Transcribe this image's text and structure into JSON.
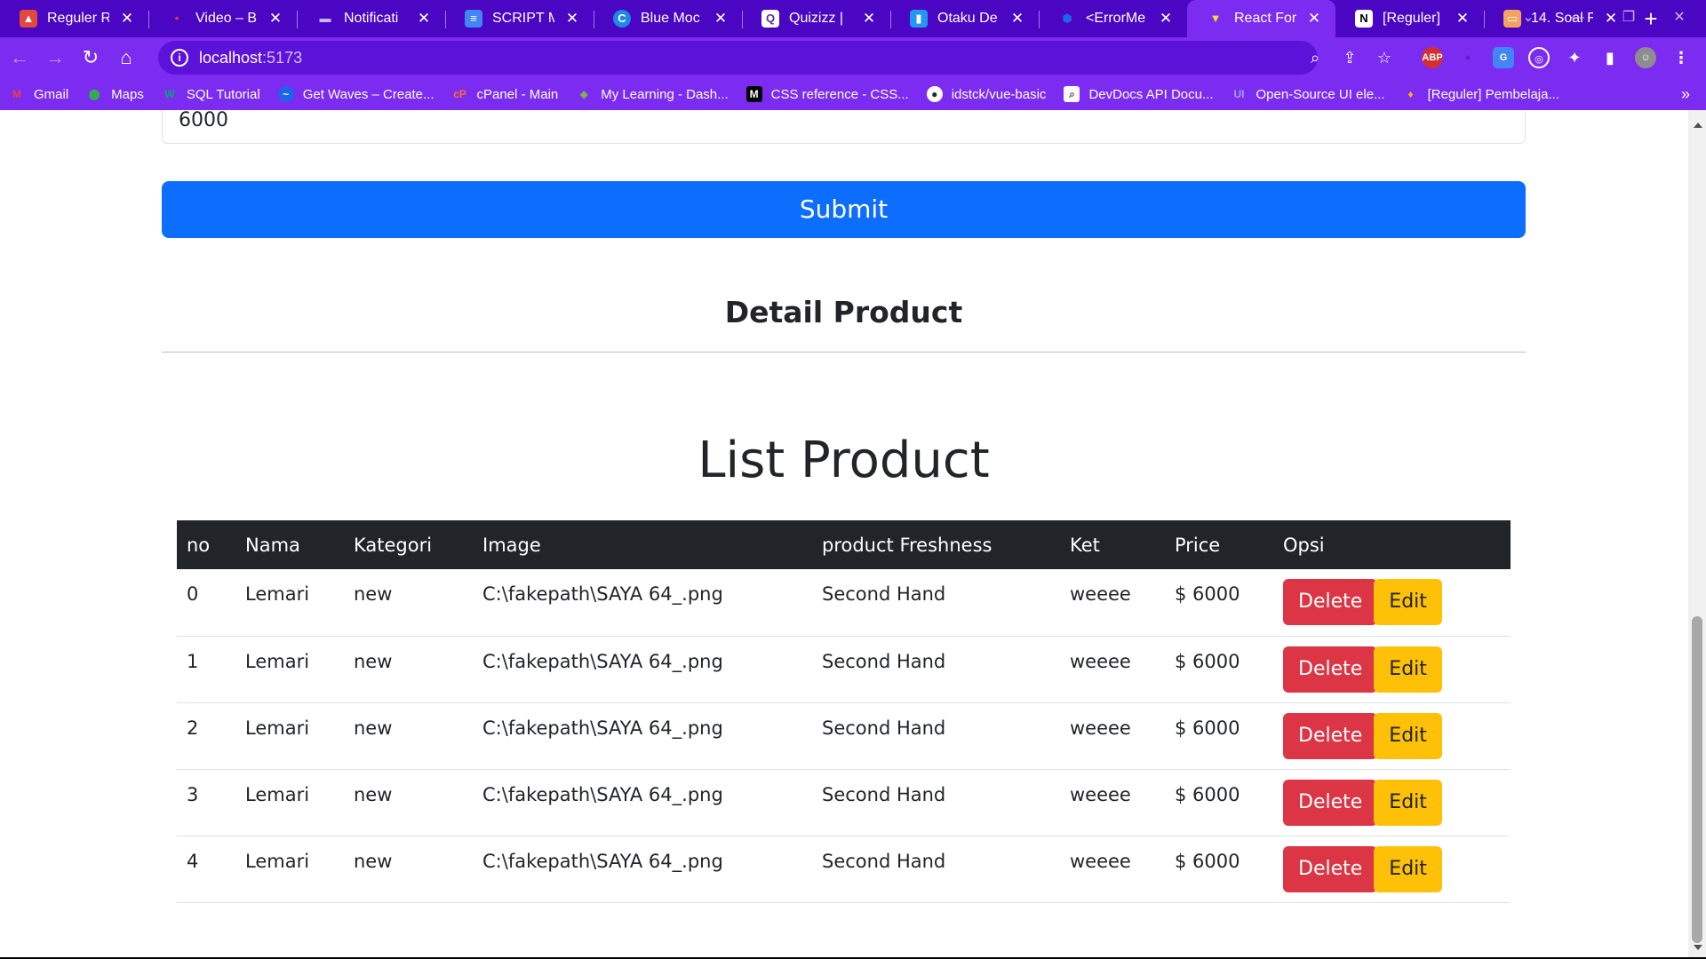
{
  "browser": {
    "tabs": [
      {
        "title": "Reguler R",
        "icon": "flame-icon",
        "color": "#e2483d"
      },
      {
        "title": "Video – B",
        "icon": "video-icon",
        "color": "#e23b3b"
      },
      {
        "title": "Notificati",
        "icon": "notification-icon",
        "color": "#8c6bd6"
      },
      {
        "title": "SCRIPT M",
        "icon": "document-icon",
        "color": "#4285f4"
      },
      {
        "title": "Blue Moc",
        "icon": "c-circle-icon",
        "color": "#1e88e5"
      },
      {
        "title": "Quizizz |",
        "icon": "quizizz-icon",
        "color": "#8e44ad"
      },
      {
        "title": "Otaku De",
        "icon": "book-icon",
        "color": "#2196f3"
      },
      {
        "title": "<ErrorMe",
        "icon": "shield-icon",
        "color": "#1565c0"
      },
      {
        "title": "React For",
        "icon": "vite-icon",
        "color": "#bd34fe",
        "active": true
      },
      {
        "title": "[Reguler]",
        "icon": "notion-icon",
        "color": "#ffffff"
      },
      {
        "title": "14. Soal F",
        "icon": "slides-icon",
        "color": "#f4a261"
      }
    ],
    "url_host": "localhost",
    "url_port": ":5173",
    "bookmarks": [
      {
        "label": "Gmail",
        "icon": "gmail-icon",
        "color": "#ea4335"
      },
      {
        "label": "Maps",
        "icon": "maps-icon",
        "color": "#34a853"
      },
      {
        "label": "SQL Tutorial",
        "icon": "w3schools-icon",
        "color": "#04aa6d"
      },
      {
        "label": "Get Waves – Create...",
        "icon": "waves-icon",
        "color": "#1e63e9"
      },
      {
        "label": "cPanel - Main",
        "icon": "cpanel-icon",
        "color": "#ff6c2c"
      },
      {
        "label": "My Learning - Dash...",
        "icon": "learning-icon",
        "color": "#7cb342"
      },
      {
        "label": "CSS reference - CSS...",
        "icon": "mdn-icon",
        "color": "#000000"
      },
      {
        "label": "idstck/vue-basic",
        "icon": "github-icon",
        "color": "#24292e"
      },
      {
        "label": "DevDocs API Docu...",
        "icon": "devdocs-icon",
        "color": "#ffffff"
      },
      {
        "label": "Open-Source UI ele...",
        "icon": "ui-icon",
        "color": "#6b5bff"
      },
      {
        "label": "[Reguler] Pembelaja...",
        "icon": "trophy-icon",
        "color": "#f5b400"
      }
    ],
    "extensions": [
      {
        "label": "ABP",
        "icon": "adblock-icon",
        "color": "#d32f2f"
      }
    ]
  },
  "form": {
    "price_value": "6000",
    "submit_label": "Submit"
  },
  "detail": {
    "title": "Detail Product"
  },
  "list": {
    "title": "List Product",
    "headers": [
      "no",
      "Nama",
      "Kategori",
      "Image",
      "product Freshness",
      "Ket",
      "Price",
      "Opsi"
    ],
    "rows": [
      {
        "no": "0",
        "nama": "Lemari",
        "kategori": "new",
        "image": "C:\\fakepath\\SAYA 64_.png",
        "freshness": "Second Hand",
        "ket": "weeee",
        "price": "$ 6000"
      },
      {
        "no": "1",
        "nama": "Lemari",
        "kategori": "new",
        "image": "C:\\fakepath\\SAYA 64_.png",
        "freshness": "Second Hand",
        "ket": "weeee",
        "price": "$ 6000"
      },
      {
        "no": "2",
        "nama": "Lemari",
        "kategori": "new",
        "image": "C:\\fakepath\\SAYA 64_.png",
        "freshness": "Second Hand",
        "ket": "weeee",
        "price": "$ 6000"
      },
      {
        "no": "3",
        "nama": "Lemari",
        "kategori": "new",
        "image": "C:\\fakepath\\SAYA 64_.png",
        "freshness": "Second Hand",
        "ket": "weeee",
        "price": "$ 6000"
      },
      {
        "no": "4",
        "nama": "Lemari",
        "kategori": "new",
        "image": "C:\\fakepath\\SAYA 64_.png",
        "freshness": "Second Hand",
        "ket": "weeee",
        "price": "$ 6000"
      }
    ],
    "delete_label": "Delete",
    "edit_label": "Edit"
  }
}
